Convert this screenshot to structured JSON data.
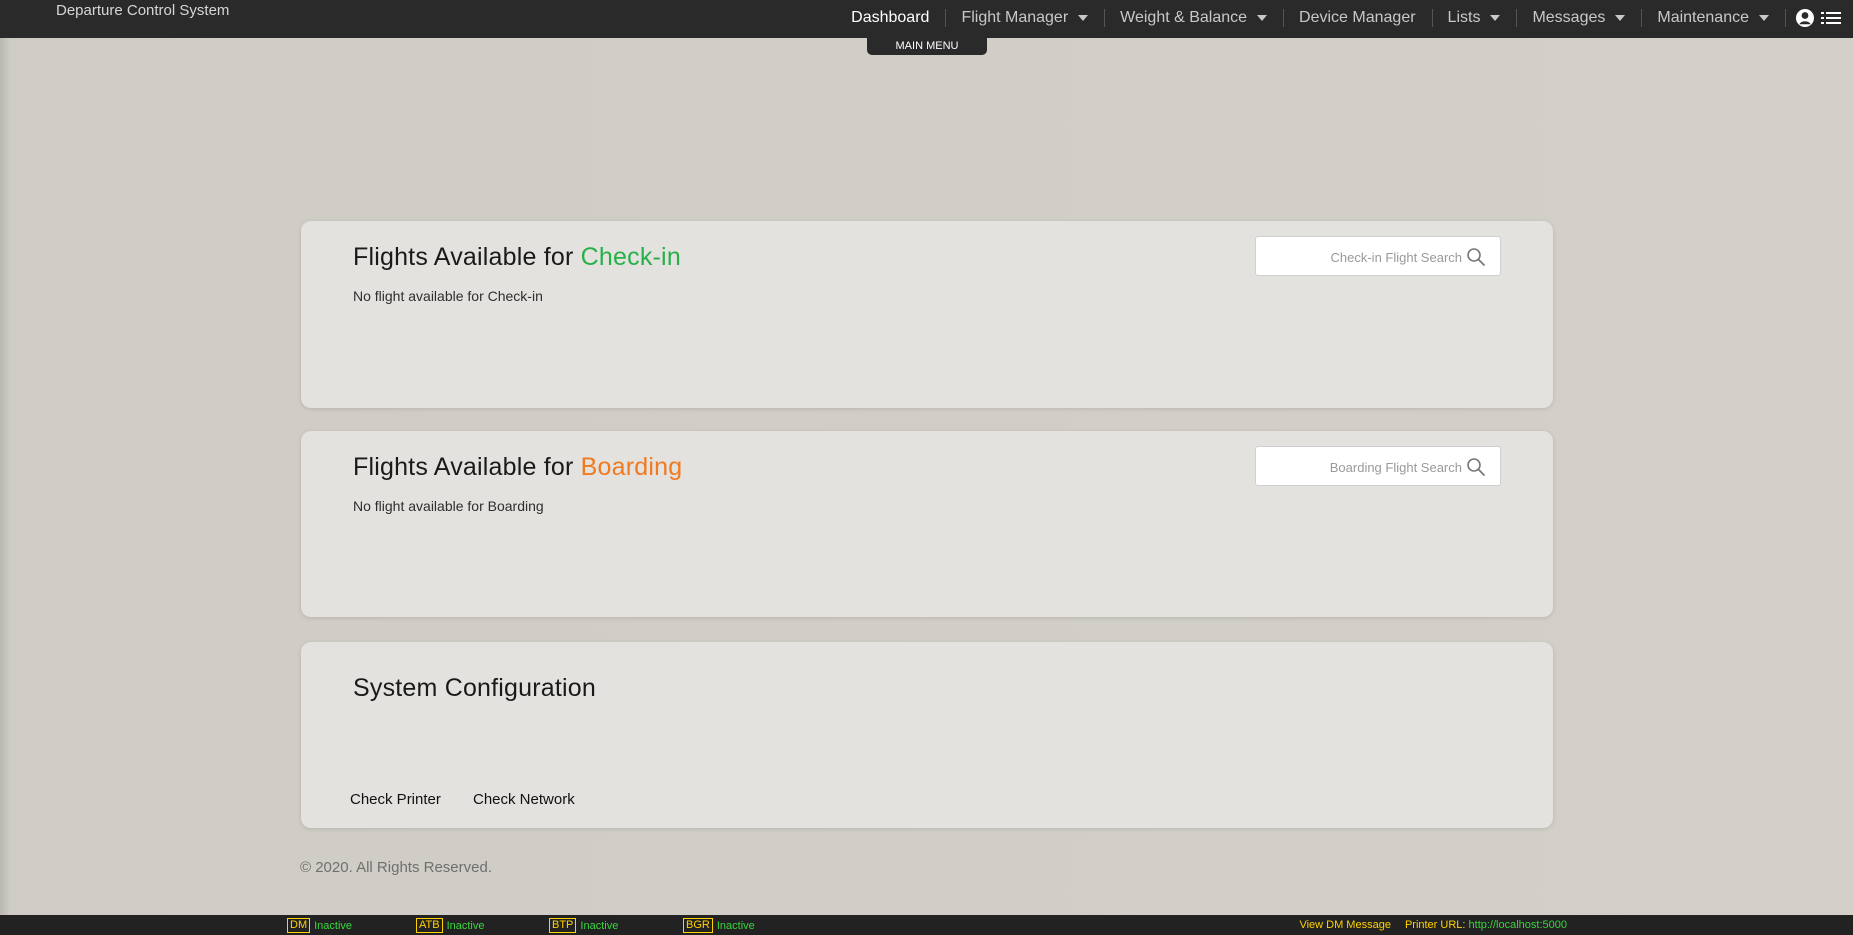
{
  "app": {
    "title": "Departure Control System"
  },
  "nav": {
    "items": [
      {
        "label": "Dashboard",
        "dropdown": false,
        "active": true
      },
      {
        "label": "Flight Manager",
        "dropdown": true
      },
      {
        "label": "Weight & Balance",
        "dropdown": true
      },
      {
        "label": "Device Manager",
        "dropdown": false
      },
      {
        "label": "Lists",
        "dropdown": true
      },
      {
        "label": "Messages",
        "dropdown": true
      },
      {
        "label": "Maintenance",
        "dropdown": true
      }
    ],
    "main_menu_label": "MAIN MENU"
  },
  "checkin": {
    "title_prefix": "Flights Available for ",
    "title_highlight": "Check-in",
    "highlight_color": "#27b04a",
    "empty_text": "No flight available for Check-in",
    "search_placeholder": "Check-in Flight Search"
  },
  "boarding": {
    "title_prefix": "Flights Available for ",
    "title_highlight": "Boarding",
    "highlight_color": "#f07a20",
    "empty_text": "No flight available for Boarding",
    "search_placeholder": "Boarding Flight Search"
  },
  "config": {
    "title": "System Configuration",
    "check_printer_label": "Check Printer",
    "check_network_label": "Check Network"
  },
  "footer": {
    "copyright": "© 2020. All Rights Reserved."
  },
  "status": {
    "items": [
      {
        "tag": "DM",
        "value": "Inactive"
      },
      {
        "tag": "ATB",
        "value": "Inactive"
      },
      {
        "tag": "BTP",
        "value": "Inactive"
      },
      {
        "tag": "BGR",
        "value": "Inactive"
      }
    ],
    "view_dm_label": "View DM Message",
    "printer_url_label": "Printer URL:",
    "printer_url_value": "http://localhost:5000"
  },
  "icons": {
    "user": "user-icon",
    "menu": "menu-list-icon",
    "search": "search-icon"
  }
}
